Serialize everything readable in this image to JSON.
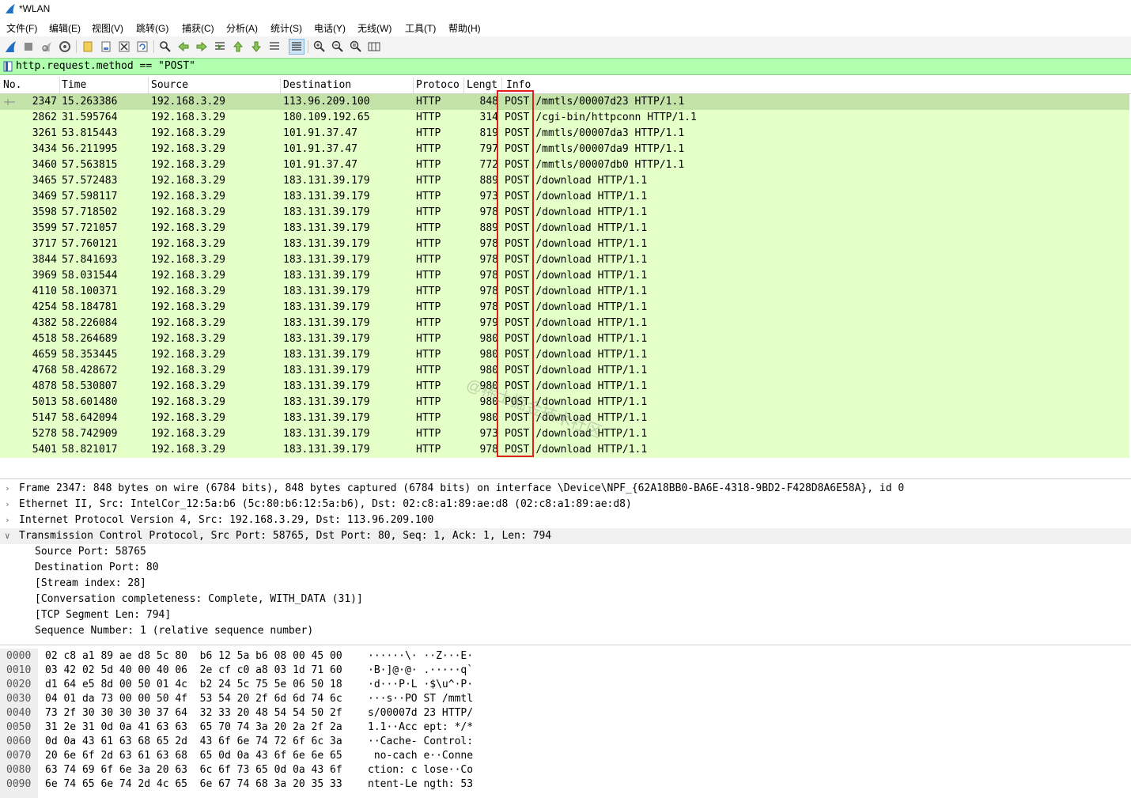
{
  "window": {
    "title": "*WLAN",
    "icon": "shark-fin-icon"
  },
  "menu": [
    "文件(F)",
    "编辑(E)",
    "视图(V)",
    "跳转(G)",
    "捕获(C)",
    "分析(A)",
    "统计(S)",
    "电话(Y)",
    "无线(W)",
    "工具(T)",
    "帮助(H)"
  ],
  "toolbar_icons": [
    "start-capture-icon",
    "stop-capture-icon",
    "restart-capture-icon",
    "capture-options-icon",
    "open-file-icon",
    "save-file-icon",
    "close-file-icon",
    "reload-file-icon",
    "find-packet-icon",
    "go-back-icon",
    "go-forward-icon",
    "go-to-packet-icon",
    "first-packet-icon",
    "last-packet-icon",
    "auto-scroll-icon",
    "colorize-icon",
    "zoom-in-icon",
    "zoom-out-icon",
    "zoom-normal-icon",
    "resize-columns-icon"
  ],
  "filter": {
    "value": "http.request.method == \"POST\""
  },
  "columns": [
    "No.",
    "Time",
    "Source",
    "Destination",
    "Protoco",
    "Lengt",
    "Info"
  ],
  "packets": [
    {
      "no": "2347",
      "time": "15.263386",
      "src": "192.168.3.29",
      "dst": "113.96.209.100",
      "proto": "HTTP",
      "len": "848",
      "method": "POST",
      "info": "/mmtls/00007d23 HTTP/1.1"
    },
    {
      "no": "2862",
      "time": "31.595764",
      "src": "192.168.3.29",
      "dst": "180.109.192.65",
      "proto": "HTTP",
      "len": "314",
      "method": "POST",
      "info": "/cgi-bin/httpconn HTTP/1.1"
    },
    {
      "no": "3261",
      "time": "53.815443",
      "src": "192.168.3.29",
      "dst": "101.91.37.47",
      "proto": "HTTP",
      "len": "819",
      "method": "POST",
      "info": "/mmtls/00007da3 HTTP/1.1"
    },
    {
      "no": "3434",
      "time": "56.211995",
      "src": "192.168.3.29",
      "dst": "101.91.37.47",
      "proto": "HTTP",
      "len": "797",
      "method": "POST",
      "info": "/mmtls/00007da9 HTTP/1.1"
    },
    {
      "no": "3460",
      "time": "57.563815",
      "src": "192.168.3.29",
      "dst": "101.91.37.47",
      "proto": "HTTP",
      "len": "772",
      "method": "POST",
      "info": "/mmtls/00007db0 HTTP/1.1"
    },
    {
      "no": "3465",
      "time": "57.572483",
      "src": "192.168.3.29",
      "dst": "183.131.39.179",
      "proto": "HTTP",
      "len": "889",
      "method": "POST",
      "info": "/download HTTP/1.1"
    },
    {
      "no": "3469",
      "time": "57.598117",
      "src": "192.168.3.29",
      "dst": "183.131.39.179",
      "proto": "HTTP",
      "len": "973",
      "method": "POST",
      "info": "/download HTTP/1.1"
    },
    {
      "no": "3598",
      "time": "57.718502",
      "src": "192.168.3.29",
      "dst": "183.131.39.179",
      "proto": "HTTP",
      "len": "978",
      "method": "POST",
      "info": "/download HTTP/1.1"
    },
    {
      "no": "3599",
      "time": "57.721057",
      "src": "192.168.3.29",
      "dst": "183.131.39.179",
      "proto": "HTTP",
      "len": "889",
      "method": "POST",
      "info": "/download HTTP/1.1"
    },
    {
      "no": "3717",
      "time": "57.760121",
      "src": "192.168.3.29",
      "dst": "183.131.39.179",
      "proto": "HTTP",
      "len": "978",
      "method": "POST",
      "info": "/download HTTP/1.1"
    },
    {
      "no": "3844",
      "time": "57.841693",
      "src": "192.168.3.29",
      "dst": "183.131.39.179",
      "proto": "HTTP",
      "len": "978",
      "method": "POST",
      "info": "/download HTTP/1.1"
    },
    {
      "no": "3969",
      "time": "58.031544",
      "src": "192.168.3.29",
      "dst": "183.131.39.179",
      "proto": "HTTP",
      "len": "978",
      "method": "POST",
      "info": "/download HTTP/1.1"
    },
    {
      "no": "4110",
      "time": "58.100371",
      "src": "192.168.3.29",
      "dst": "183.131.39.179",
      "proto": "HTTP",
      "len": "978",
      "method": "POST",
      "info": "/download HTTP/1.1"
    },
    {
      "no": "4254",
      "time": "58.184781",
      "src": "192.168.3.29",
      "dst": "183.131.39.179",
      "proto": "HTTP",
      "len": "978",
      "method": "POST",
      "info": "/download HTTP/1.1"
    },
    {
      "no": "4382",
      "time": "58.226084",
      "src": "192.168.3.29",
      "dst": "183.131.39.179",
      "proto": "HTTP",
      "len": "979",
      "method": "POST",
      "info": "/download HTTP/1.1"
    },
    {
      "no": "4518",
      "time": "58.264689",
      "src": "192.168.3.29",
      "dst": "183.131.39.179",
      "proto": "HTTP",
      "len": "980",
      "method": "POST",
      "info": "/download HTTP/1.1"
    },
    {
      "no": "4659",
      "time": "58.353445",
      "src": "192.168.3.29",
      "dst": "183.131.39.179",
      "proto": "HTTP",
      "len": "980",
      "method": "POST",
      "info": "/download HTTP/1.1"
    },
    {
      "no": "4768",
      "time": "58.428672",
      "src": "192.168.3.29",
      "dst": "183.131.39.179",
      "proto": "HTTP",
      "len": "980",
      "method": "POST",
      "info": "/download HTTP/1.1"
    },
    {
      "no": "4878",
      "time": "58.530807",
      "src": "192.168.3.29",
      "dst": "183.131.39.179",
      "proto": "HTTP",
      "len": "980",
      "method": "POST",
      "info": "/download HTTP/1.1"
    },
    {
      "no": "5013",
      "time": "58.601480",
      "src": "192.168.3.29",
      "dst": "183.131.39.179",
      "proto": "HTTP",
      "len": "980",
      "method": "POST",
      "info": "/download HTTP/1.1"
    },
    {
      "no": "5147",
      "time": "58.642094",
      "src": "192.168.3.29",
      "dst": "183.131.39.179",
      "proto": "HTTP",
      "len": "980",
      "method": "POST",
      "info": "/download HTTP/1.1"
    },
    {
      "no": "5278",
      "time": "58.742909",
      "src": "192.168.3.29",
      "dst": "183.131.39.179",
      "proto": "HTTP",
      "len": "973",
      "method": "POST",
      "info": "/download HTTP/1.1"
    },
    {
      "no": "5401",
      "time": "58.821017",
      "src": "192.168.3.29",
      "dst": "183.131.39.179",
      "proto": "HTTP",
      "len": "978",
      "method": "POST",
      "info": "/download HTTP/1.1"
    }
  ],
  "details": [
    {
      "text": "Frame 2347: 848 bytes on wire (6784 bits), 848 bytes captured (6784 bits) on interface \\Device\\NPF_{62A18BB0-BA6E-4318-9BD2-F428D8A6E58A}, id 0",
      "level": 0,
      "state": "collapsed"
    },
    {
      "text": "Ethernet II, Src: IntelCor_12:5a:b6 (5c:80:b6:12:5a:b6), Dst: 02:c8:a1:89:ae:d8 (02:c8:a1:89:ae:d8)",
      "level": 0,
      "state": "collapsed"
    },
    {
      "text": "Internet Protocol Version 4, Src: 192.168.3.29, Dst: 113.96.209.100",
      "level": 0,
      "state": "collapsed"
    },
    {
      "text": "Transmission Control Protocol, Src Port: 58765, Dst Port: 80, Seq: 1, Ack: 1, Len: 794",
      "level": 0,
      "state": "expanded"
    },
    {
      "text": "Source Port: 58765",
      "level": 1,
      "state": "none"
    },
    {
      "text": "Destination Port: 80",
      "level": 1,
      "state": "none"
    },
    {
      "text": "[Stream index: 28]",
      "level": 1,
      "state": "none"
    },
    {
      "text": "[Conversation completeness: Complete, WITH_DATA (31)]",
      "level": 1,
      "state": "none"
    },
    {
      "text": "[TCP Segment Len: 794]",
      "level": 1,
      "state": "none"
    },
    {
      "text": "Sequence Number: 1    (relative sequence number)",
      "level": 1,
      "state": "none"
    }
  ],
  "bytes": [
    {
      "off": "0000",
      "hex": "02 c8 a1 89 ae d8 5c 80  b6 12 5a b6 08 00 45 00",
      "ascii": "······\\· ··Z···E·"
    },
    {
      "off": "0010",
      "hex": "03 42 02 5d 40 00 40 06  2e cf c0 a8 03 1d 71 60",
      "ascii": "·B·]@·@· .·····q`"
    },
    {
      "off": "0020",
      "hex": "d1 64 e5 8d 00 50 01 4c  b2 24 5c 75 5e 06 50 18",
      "ascii": "·d···P·L ·$\\u^·P·"
    },
    {
      "off": "0030",
      "hex": "04 01 da 73 00 00 50 4f  53 54 20 2f 6d 6d 74 6c",
      "ascii": "···s··PO ST /mmtl"
    },
    {
      "off": "0040",
      "hex": "73 2f 30 30 30 30 37 64  32 33 20 48 54 54 50 2f",
      "ascii": "s/00007d 23 HTTP/"
    },
    {
      "off": "0050",
      "hex": "31 2e 31 0d 0a 41 63 63  65 70 74 3a 20 2a 2f 2a",
      "ascii": "1.1··Acc ept: */*"
    },
    {
      "off": "0060",
      "hex": "0d 0a 43 61 63 68 65 2d  43 6f 6e 74 72 6f 6c 3a",
      "ascii": "··Cache- Control:"
    },
    {
      "off": "0070",
      "hex": "20 6e 6f 2d 63 61 63 68  65 0d 0a 43 6f 6e 6e 65",
      "ascii": " no-cach e··Conne"
    },
    {
      "off": "0080",
      "hex": "63 74 69 6f 6e 3a 20 63  6c 6f 73 65 0d 0a 43 6f",
      "ascii": "ction: c lose··Co"
    },
    {
      "off": "0090",
      "hex": "6e 74 65 6e 74 2d 4c 65  6e 67 74 68 3a 20 35 33",
      "ascii": "ntent-Le ngth: 53"
    }
  ],
  "watermark": "@稀土掘金技术社区"
}
